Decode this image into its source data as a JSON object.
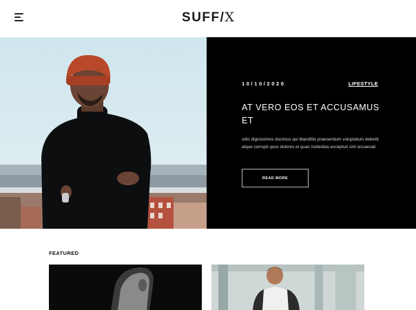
{
  "header": {
    "logo_main": "SUFF",
    "logo_i": "/",
    "logo_x": "X",
    "menu_icon": "hamburger-menu-icon"
  },
  "hero": {
    "date": "10/10/2020",
    "category": "LIFESTYLE",
    "title": "AT VERO EOS ET ACCUSAMUS ET",
    "excerpt": "odio dignissimos ducimus qui blanditiis praesentium voluptatum deleniti atque corrupti quos dolores et quas molestias excepturi sint occaecati",
    "button_label": "READ MORE"
  },
  "featured": {
    "label": "FEATURED"
  }
}
